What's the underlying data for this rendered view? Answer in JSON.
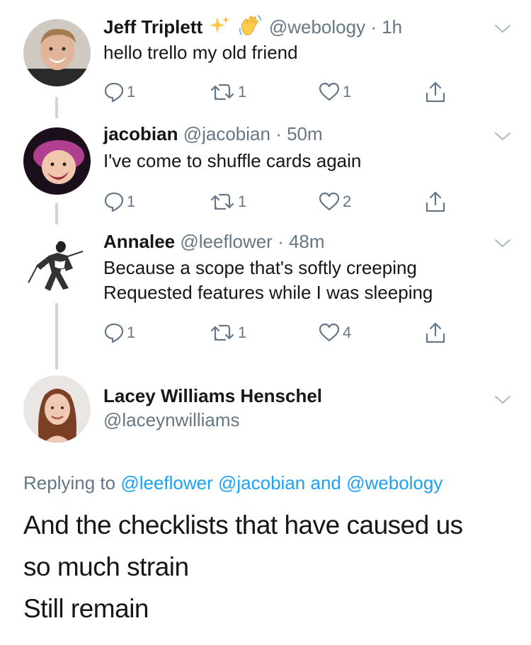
{
  "tweets": [
    {
      "name": "Jeff Triplett",
      "handle": "@webology",
      "separator": "·",
      "time": "1h",
      "text_lines": [
        "hello trello my old friend"
      ],
      "replies": "1",
      "retweets": "1",
      "likes": "1",
      "emoji": [
        "sparkles-icon",
        "waving-hand-icon"
      ]
    },
    {
      "name": "jacobian",
      "handle": "@jacobian",
      "separator": "·",
      "time": "50m",
      "text_lines": [
        "I've come to shuffle cards again"
      ],
      "replies": "1",
      "retweets": "1",
      "likes": "2"
    },
    {
      "name": "Annalee",
      "handle": "@leeflower",
      "separator": "·",
      "time": "48m",
      "text_lines": [
        "Because a scope that's softly creeping",
        "Requested features while I was sleeping"
      ],
      "replies": "1",
      "retweets": "1",
      "likes": "4"
    }
  ],
  "main_tweet": {
    "name": "Lacey Williams Henschel",
    "handle": "@laceynwilliams",
    "replying_prefix": "Replying to",
    "replying_to": [
      "@leeflower",
      "@jacobian"
    ],
    "replying_and": "and",
    "replying_last": "@webology",
    "text_lines": [
      "And the checklists that have caused us",
      "so much strain",
      "Still remain"
    ]
  },
  "colors": {
    "link": "#1da1f2",
    "muted": "#657786",
    "text": "#14171a",
    "thread_line": "#ccd6dd"
  }
}
